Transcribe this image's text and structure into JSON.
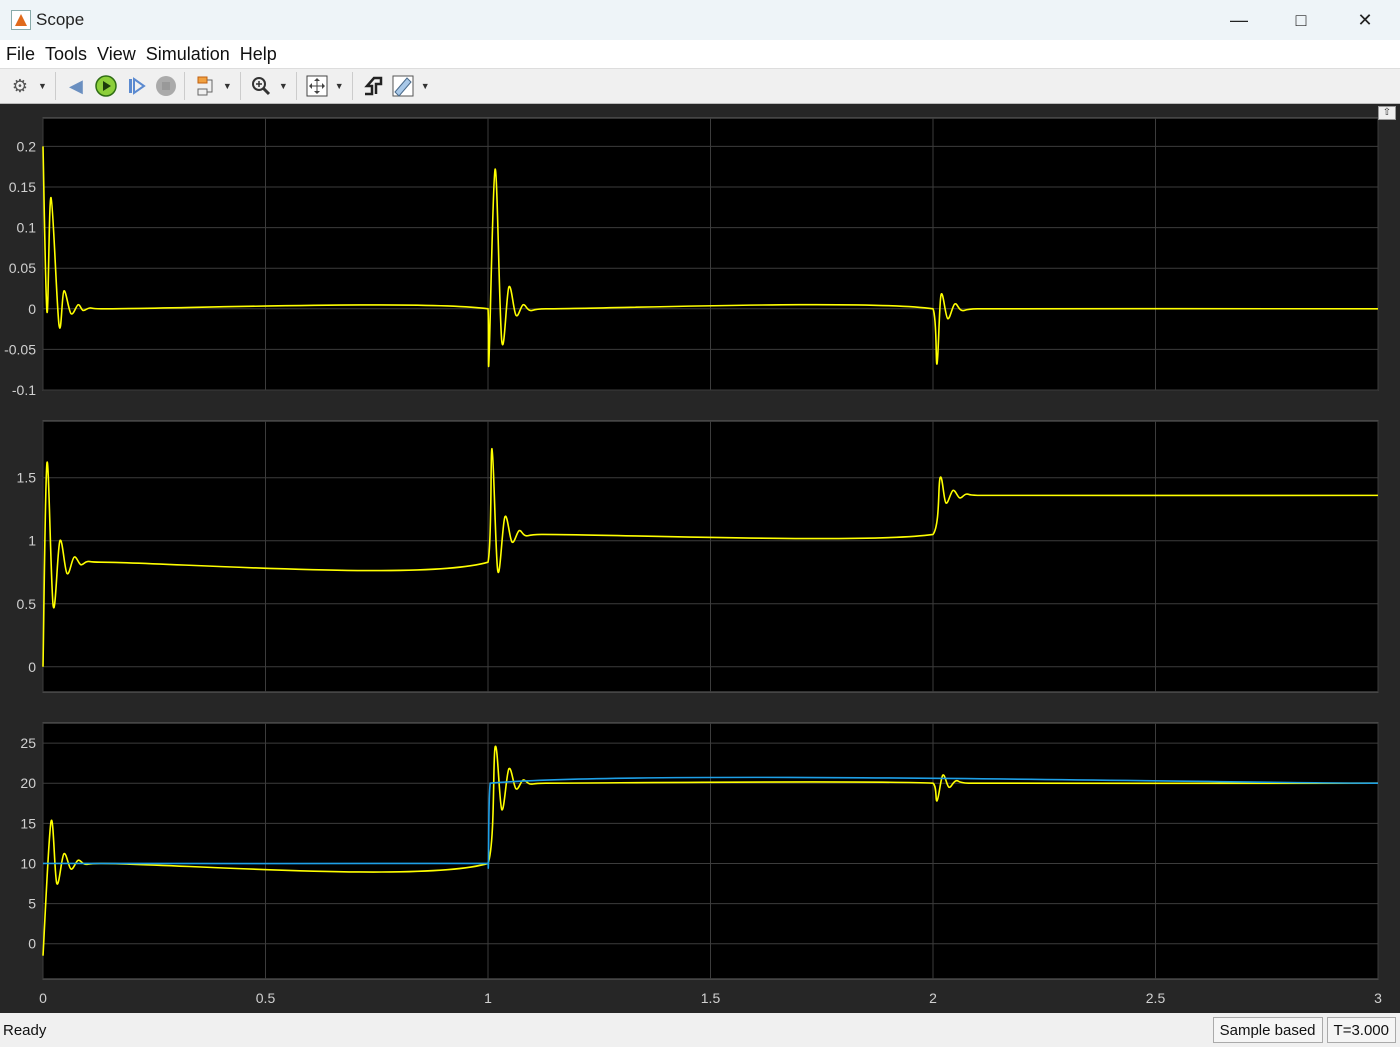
{
  "window": {
    "title": "Scope"
  },
  "menu": [
    {
      "label": "File"
    },
    {
      "label": "Tools"
    },
    {
      "label": "View"
    },
    {
      "label": "Simulation"
    },
    {
      "label": "Help"
    }
  ],
  "toolbar": [
    "gear-icon",
    "step-back-icon",
    "run-icon",
    "step-forward-icon",
    "stop-icon",
    "highlight-block-icon",
    "zoom-icon",
    "fit-axes-icon",
    "triggers-icon",
    "measurements-icon"
  ],
  "status": {
    "text": "Ready",
    "mode": "Sample based",
    "time": "T=3.000"
  },
  "colors": {
    "axes_bg": "#000000",
    "grid": "#3c3c3c",
    "signal1": "#ffff00",
    "signal2": "#1e9fe6",
    "tick": "#d0d0d0"
  },
  "chart_data": [
    {
      "type": "line",
      "xlim": [
        0,
        3
      ],
      "ylim": [
        -0.1,
        0.235
      ],
      "grid": true,
      "xticks": [
        "0",
        "0.5",
        "1",
        "1.5",
        "2",
        "2.5",
        "3"
      ],
      "yticks": [
        {
          "v": -0.1,
          "l": "-0.1"
        },
        {
          "v": -0.05,
          "l": "-0.05"
        },
        {
          "v": 0,
          "l": "0"
        },
        {
          "v": 0.05,
          "l": "0.05"
        },
        {
          "v": 0.1,
          "l": "0.1"
        },
        {
          "v": 0.15,
          "l": "0.15"
        },
        {
          "v": 0.2,
          "l": "0.2"
        }
      ],
      "series": [
        {
          "name": "signal1",
          "color": "#ffff00",
          "points": [
            [
              0,
              0.2
            ],
            [
              0.009,
              -0.004
            ],
            [
              0.018,
              0.137
            ],
            [
              0.036,
              -0.02
            ],
            [
              0.047,
              0.022
            ],
            [
              0.063,
              -0.006
            ],
            [
              0.079,
              0.005
            ],
            [
              0.09,
              -0.002
            ],
            [
              0.105,
              0.001
            ],
            [
              0.13,
              0
            ],
            [
              1.0,
              0
            ],
            [
              1.002,
              -0.065
            ],
            [
              1.016,
              0.172
            ],
            [
              1.031,
              -0.04
            ],
            [
              1.047,
              0.027
            ],
            [
              1.063,
              -0.008
            ],
            [
              1.079,
              0.005
            ],
            [
              1.095,
              -0.002
            ],
            [
              1.13,
              0
            ],
            [
              2.0,
              0
            ],
            [
              2.009,
              -0.068
            ],
            [
              2.018,
              0.017
            ],
            [
              2.033,
              -0.012
            ],
            [
              2.049,
              0.006
            ],
            [
              2.065,
              -0.002
            ],
            [
              2.1,
              0
            ],
            [
              3,
              0
            ]
          ]
        }
      ]
    },
    {
      "type": "line",
      "xlim": [
        0,
        3
      ],
      "ylim": [
        -0.2,
        1.95
      ],
      "grid": true,
      "xticks": [
        "0",
        "0.5",
        "1",
        "1.5",
        "2",
        "2.5",
        "3"
      ],
      "yticks": [
        {
          "v": 0,
          "l": "0"
        },
        {
          "v": 0.5,
          "l": "0.5"
        },
        {
          "v": 1,
          "l": "1"
        },
        {
          "v": 1.5,
          "l": "1.5"
        }
      ],
      "series": [
        {
          "name": "signal1",
          "color": "#ffff00",
          "points": [
            [
              0,
              0
            ],
            [
              0.009,
              1.62
            ],
            [
              0.023,
              0.48
            ],
            [
              0.038,
              1.0
            ],
            [
              0.054,
              0.74
            ],
            [
              0.07,
              0.87
            ],
            [
              0.085,
              0.81
            ],
            [
              0.1,
              0.835
            ],
            [
              0.13,
              0.83
            ],
            [
              1.0,
              0.83
            ],
            [
              1.009,
              1.73
            ],
            [
              1.022,
              0.76
            ],
            [
              1.038,
              1.19
            ],
            [
              1.054,
              0.99
            ],
            [
              1.07,
              1.08
            ],
            [
              1.085,
              1.04
            ],
            [
              1.12,
              1.05
            ],
            [
              2.0,
              1.05
            ],
            [
              2.016,
              1.5
            ],
            [
              2.029,
              1.3
            ],
            [
              2.045,
              1.4
            ],
            [
              2.06,
              1.34
            ],
            [
              2.075,
              1.37
            ],
            [
              2.1,
              1.36
            ],
            [
              3,
              1.36
            ]
          ]
        }
      ]
    },
    {
      "type": "line",
      "xlim": [
        0,
        3
      ],
      "ylim": [
        -4.4,
        27.5
      ],
      "grid": true,
      "xticks": [
        "0",
        "0.5",
        "1",
        "1.5",
        "2",
        "2.5",
        "3"
      ],
      "yticks": [
        {
          "v": 0,
          "l": "0"
        },
        {
          "v": 5,
          "l": "5"
        },
        {
          "v": 10,
          "l": "10"
        },
        {
          "v": 15,
          "l": "15"
        },
        {
          "v": 20,
          "l": "20"
        },
        {
          "v": 25,
          "l": "25"
        }
      ],
      "series": [
        {
          "name": "signal1",
          "color": "#ffff00",
          "points": [
            [
              0,
              -1.5
            ],
            [
              0.018,
              15.2
            ],
            [
              0.031,
              7.5
            ],
            [
              0.047,
              11.2
            ],
            [
              0.063,
              9.3
            ],
            [
              0.079,
              10.4
            ],
            [
              0.095,
              9.9
            ],
            [
              0.13,
              10
            ],
            [
              1.0,
              10
            ],
            [
              1.016,
              24.5
            ],
            [
              1.031,
              16.7
            ],
            [
              1.047,
              21.8
            ],
            [
              1.063,
              19.3
            ],
            [
              1.079,
              20.4
            ],
            [
              1.095,
              19.9
            ],
            [
              1.13,
              20
            ],
            [
              2.0,
              20
            ],
            [
              2.009,
              17.8
            ],
            [
              2.022,
              21
            ],
            [
              2.036,
              19.5
            ],
            [
              2.052,
              20.3
            ],
            [
              2.08,
              20
            ],
            [
              3,
              20
            ]
          ]
        },
        {
          "name": "signal2",
          "color": "#1e9fe6",
          "points": [
            [
              0,
              10
            ],
            [
              1.0,
              10
            ],
            [
              1.001,
              10.2
            ],
            [
              1.005,
              20
            ],
            [
              3,
              20
            ]
          ]
        }
      ]
    }
  ]
}
